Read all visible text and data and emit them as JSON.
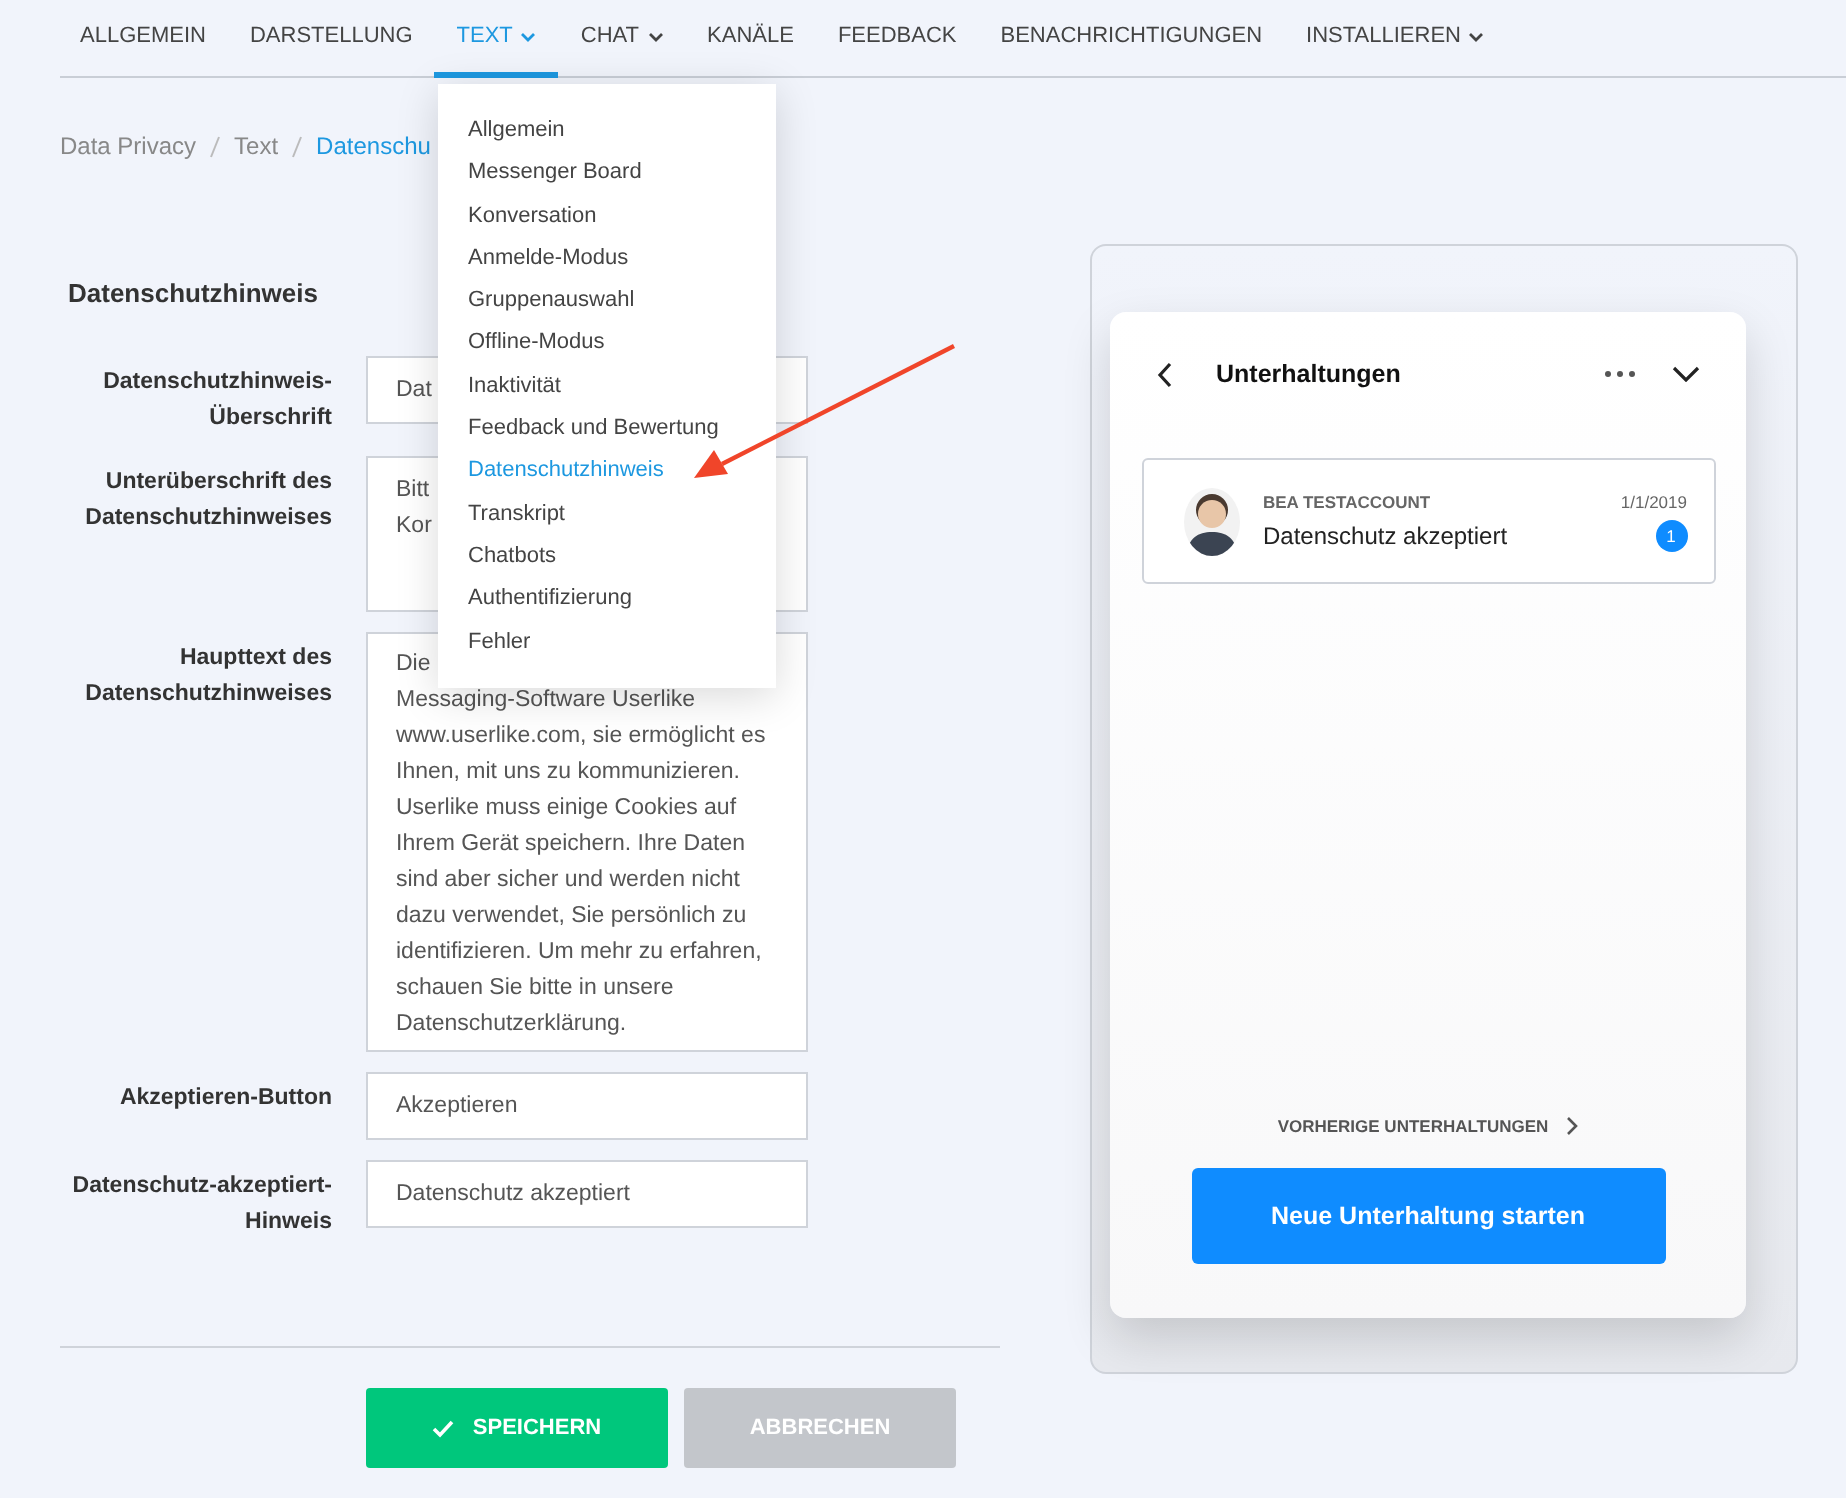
{
  "nav": {
    "tabs": [
      {
        "label": "ALLGEMEIN",
        "selected": false,
        "caret": false
      },
      {
        "label": "DARSTELLUNG",
        "selected": false,
        "caret": false
      },
      {
        "label": "TEXT",
        "selected": true,
        "caret": true
      },
      {
        "label": "CHAT",
        "selected": false,
        "caret": true
      },
      {
        "label": "KANÄLE",
        "selected": false,
        "caret": false
      },
      {
        "label": "FEEDBACK",
        "selected": false,
        "caret": false
      },
      {
        "label": "BENACHRICHTIGUNGEN",
        "selected": false,
        "caret": false
      },
      {
        "label": "INSTALLIEREN",
        "selected": false,
        "caret": true
      }
    ]
  },
  "breadcrumb": [
    {
      "label": "Data Privacy",
      "selected": false
    },
    {
      "label": "Text",
      "selected": false
    },
    {
      "label": "Datenschu",
      "selected": true
    }
  ],
  "dropdown": {
    "items": [
      {
        "label": "Allgemein",
        "selected": false
      },
      {
        "label": "Messenger Board",
        "selected": false
      },
      {
        "label": "Konversation",
        "selected": false
      },
      {
        "label": "Anmelde-Modus",
        "selected": false
      },
      {
        "label": "Gruppenauswahl",
        "selected": false
      },
      {
        "label": "Offline-Modus",
        "selected": false
      },
      {
        "label": "Inaktivität",
        "selected": false
      },
      {
        "label": "Feedback und Bewertung",
        "selected": false
      },
      {
        "label": "Datenschutzhinweis",
        "selected": true
      },
      {
        "label": "Transkript",
        "selected": false
      },
      {
        "label": "Chatbots",
        "selected": false
      },
      {
        "label": "Authentifizierung",
        "selected": false
      },
      {
        "label": "Fehler",
        "selected": false
      }
    ]
  },
  "form": {
    "title": "Datenschutzhinweis",
    "fields": [
      {
        "label": "Datenschutzhinweis-Überschrift",
        "value": "Dat",
        "kind": "input"
      },
      {
        "label": "Unterüberschrift des Datenschutzhinweises",
        "value": "Bitt\nKor",
        "kind": "textarea"
      },
      {
        "label": "Haupttext des Datenschutzhinweises",
        "value": "Die\nMessaging-Software Userlike www.userlike.com, sie ermöglicht es Ihnen, mit uns zu kommunizieren. Userlike muss einige Cookies auf Ihrem Gerät speichern. Ihre Daten sind aber sicher und werden nicht dazu verwendet, Sie persönlich zu identifizieren. Um mehr zu erfahren, schauen Sie bitte in unsere Datenschutzerklärung.",
        "kind": "longtext"
      },
      {
        "label": "Akzeptieren-Button",
        "value": "Akzeptieren",
        "kind": "input"
      },
      {
        "label": "Datenschutz-akzeptiert-Hinweis",
        "value": "Datenschutz akzeptiert",
        "kind": "input"
      }
    ]
  },
  "buttons": [
    {
      "label": "SPEICHERN",
      "disabled": false
    },
    {
      "label": "ABBRECHEN",
      "disabled": true
    }
  ],
  "preview": {
    "title": "Unterhaltungen",
    "conversation": {
      "name": "BEA TESTACCOUNT",
      "date": "1/1/2019",
      "message": "Datenschutz akzeptiert",
      "unread": "1"
    },
    "previous_link": "VORHERIGE UNTERHALTUNGEN",
    "start_button": "Neue Unterhaltung starten"
  }
}
